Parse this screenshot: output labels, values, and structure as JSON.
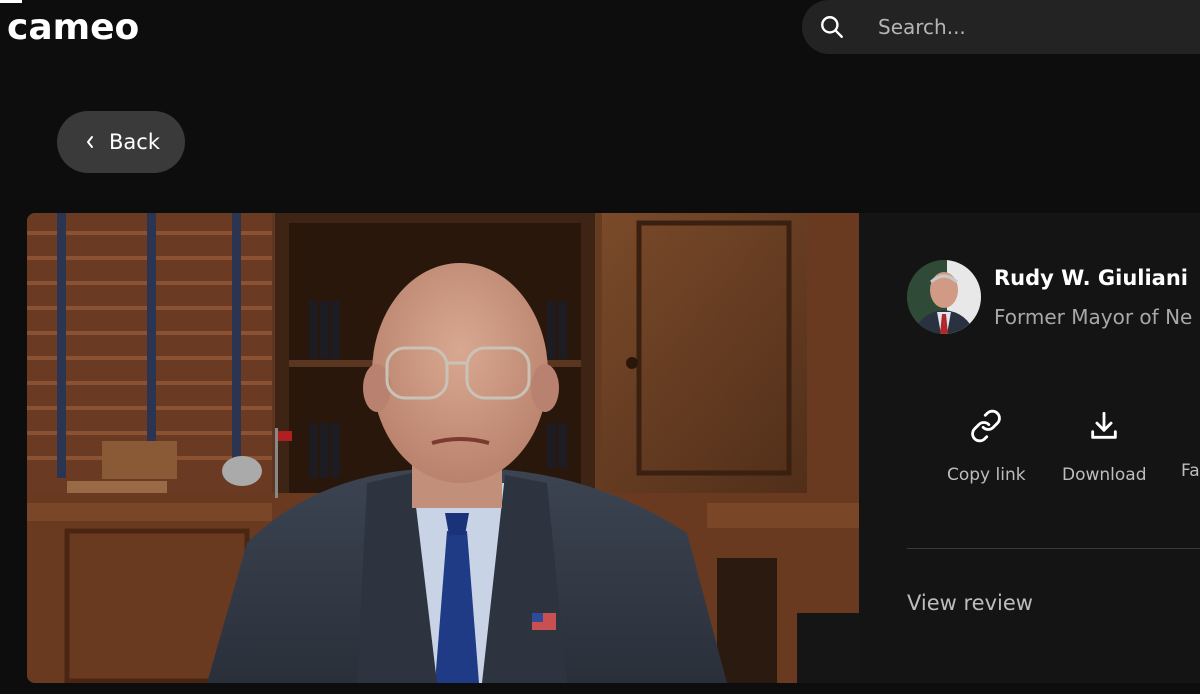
{
  "header": {
    "logo": "cameo",
    "search": {
      "placeholder": "Search..."
    }
  },
  "back_label": "Back",
  "talent": {
    "name": "Rudy W. Giuliani",
    "title": "Former Mayor of Ne"
  },
  "actions": [
    {
      "label": "Copy link",
      "icon": "link-icon"
    },
    {
      "label": "Download",
      "icon": "download-icon"
    },
    {
      "label": "Fa",
      "icon": "favorite-icon"
    }
  ],
  "view_review_label": "View review"
}
